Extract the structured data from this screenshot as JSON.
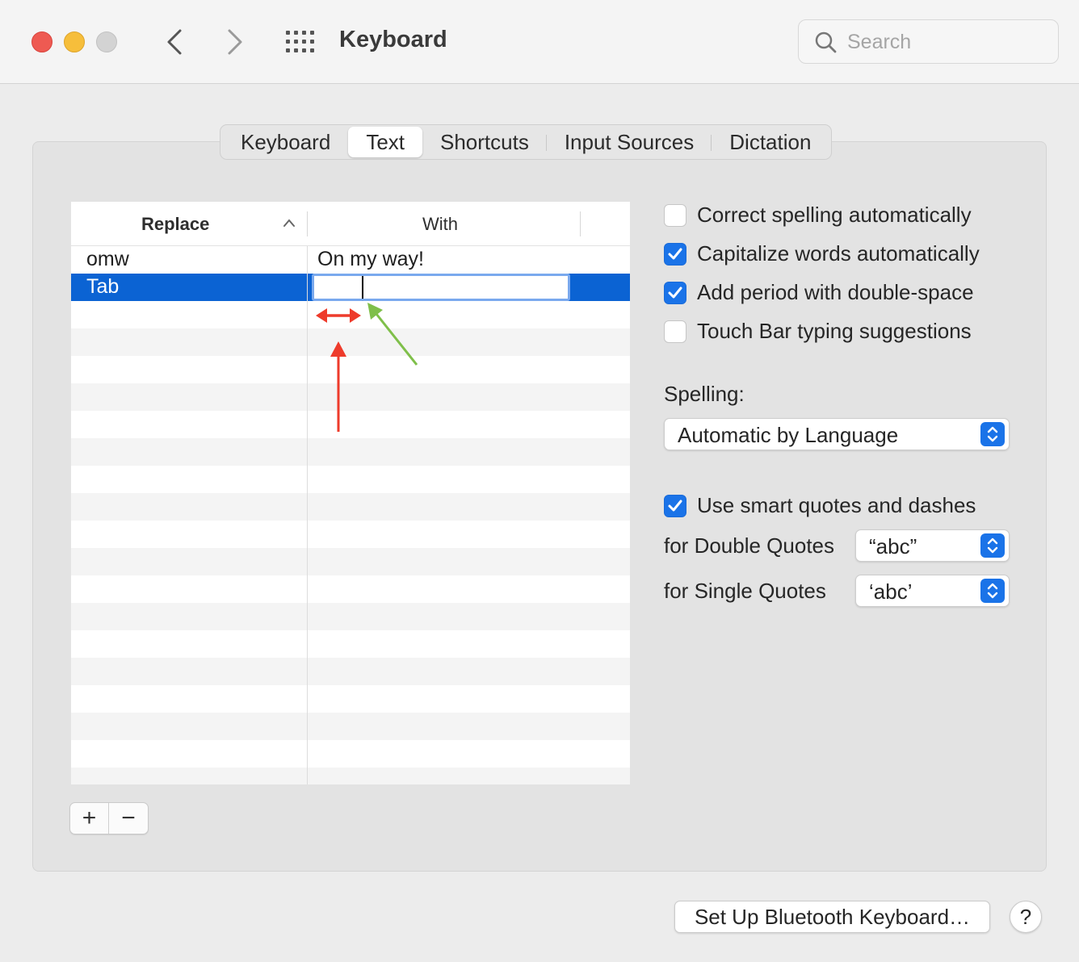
{
  "window": {
    "title": "Keyboard",
    "search_placeholder": "Search"
  },
  "tabs": [
    {
      "label": "Keyboard",
      "active": false
    },
    {
      "label": "Text",
      "active": true
    },
    {
      "label": "Shortcuts",
      "active": false
    },
    {
      "label": "Input Sources",
      "active": false
    },
    {
      "label": "Dictation",
      "active": false
    }
  ],
  "table": {
    "headers": {
      "replace": "Replace",
      "with": "With"
    },
    "rows": [
      {
        "replace": "omw",
        "with": "On my way!",
        "selected": false
      },
      {
        "replace": "Tab",
        "with": "",
        "selected": true
      }
    ]
  },
  "options": {
    "correct_spelling": {
      "label": "Correct spelling automatically",
      "checked": false
    },
    "capitalize": {
      "label": "Capitalize words automatically",
      "checked": true
    },
    "add_period": {
      "label": "Add period with double-space",
      "checked": true
    },
    "touchbar": {
      "label": "Touch Bar typing suggestions",
      "checked": false
    },
    "spelling_label": "Spelling:",
    "spelling_value": "Automatic by Language",
    "smart_quotes": {
      "label": "Use smart quotes and dashes",
      "checked": true
    },
    "double_quotes_label": "for Double Quotes",
    "double_quotes_value": "“abc”",
    "single_quotes_label": "for Single Quotes",
    "single_quotes_value": "‘abc’"
  },
  "buttons": {
    "add": "+",
    "remove": "−",
    "bluetooth": "Set Up Bluetooth Keyboard…",
    "help": "?"
  },
  "colors": {
    "accent": "#1a73e8",
    "selection": "#0b63d3",
    "annotation_red": "#ee3b2b",
    "annotation_green": "#7fbf4a"
  }
}
